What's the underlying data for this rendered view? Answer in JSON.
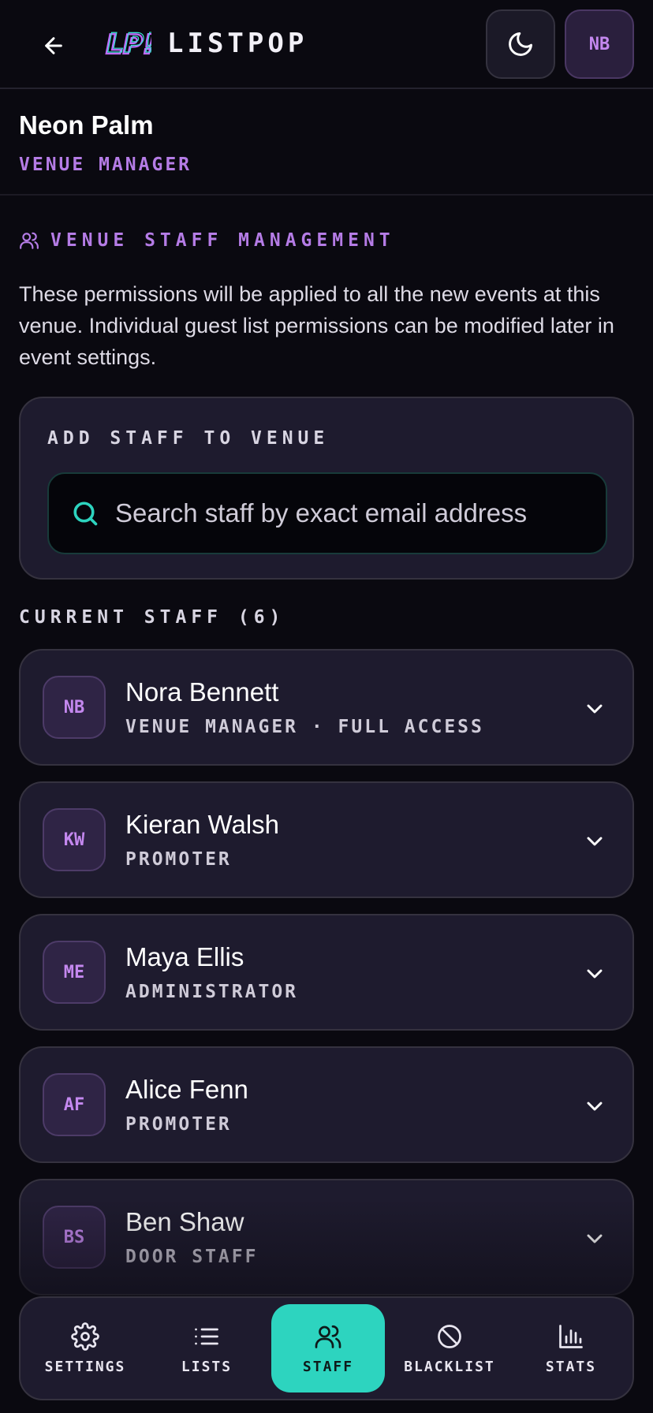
{
  "header": {
    "brand": "LISTPOP",
    "logo_text": "LP!",
    "avatar_initials": "NB",
    "back_icon": "arrow-left-icon",
    "theme_icon": "moon-icon"
  },
  "venue": {
    "name": "Neon Palm",
    "role": "VENUE MANAGER"
  },
  "staff_section": {
    "heading": "VENUE STAFF MANAGEMENT",
    "icon": "users-icon",
    "description": "These permissions will be applied to all the new events at this venue. Individual guest list permissions can be modified later in event settings."
  },
  "add_staff": {
    "title": "ADD STAFF TO VENUE",
    "search_placeholder": "Search staff by exact email address"
  },
  "current_staff": {
    "heading": "CURRENT STAFF (6)",
    "members": [
      {
        "initials": "NB",
        "name": "Nora Bennett",
        "role": "VENUE MANAGER · FULL ACCESS"
      },
      {
        "initials": "KW",
        "name": "Kieran Walsh",
        "role": "PROMOTER"
      },
      {
        "initials": "ME",
        "name": "Maya Ellis",
        "role": "ADMINISTRATOR"
      },
      {
        "initials": "AF",
        "name": "Alice Fenn",
        "role": "PROMOTER"
      },
      {
        "initials": "BS",
        "name": "Ben Shaw",
        "role": "DOOR STAFF"
      }
    ]
  },
  "nav": {
    "items": [
      {
        "label": "SETTINGS",
        "icon": "gear-icon"
      },
      {
        "label": "LISTS",
        "icon": "list-icon"
      },
      {
        "label": "STAFF",
        "icon": "users-icon",
        "active": true
      },
      {
        "label": "BLACKLIST",
        "icon": "ban-icon"
      },
      {
        "label": "STATS",
        "icon": "bar-chart-icon"
      }
    ]
  },
  "colors": {
    "background": "#0a0910",
    "card": "#1e1b2e",
    "accent_purple": "#b57ce6",
    "accent_teal": "#2dd4bf"
  }
}
